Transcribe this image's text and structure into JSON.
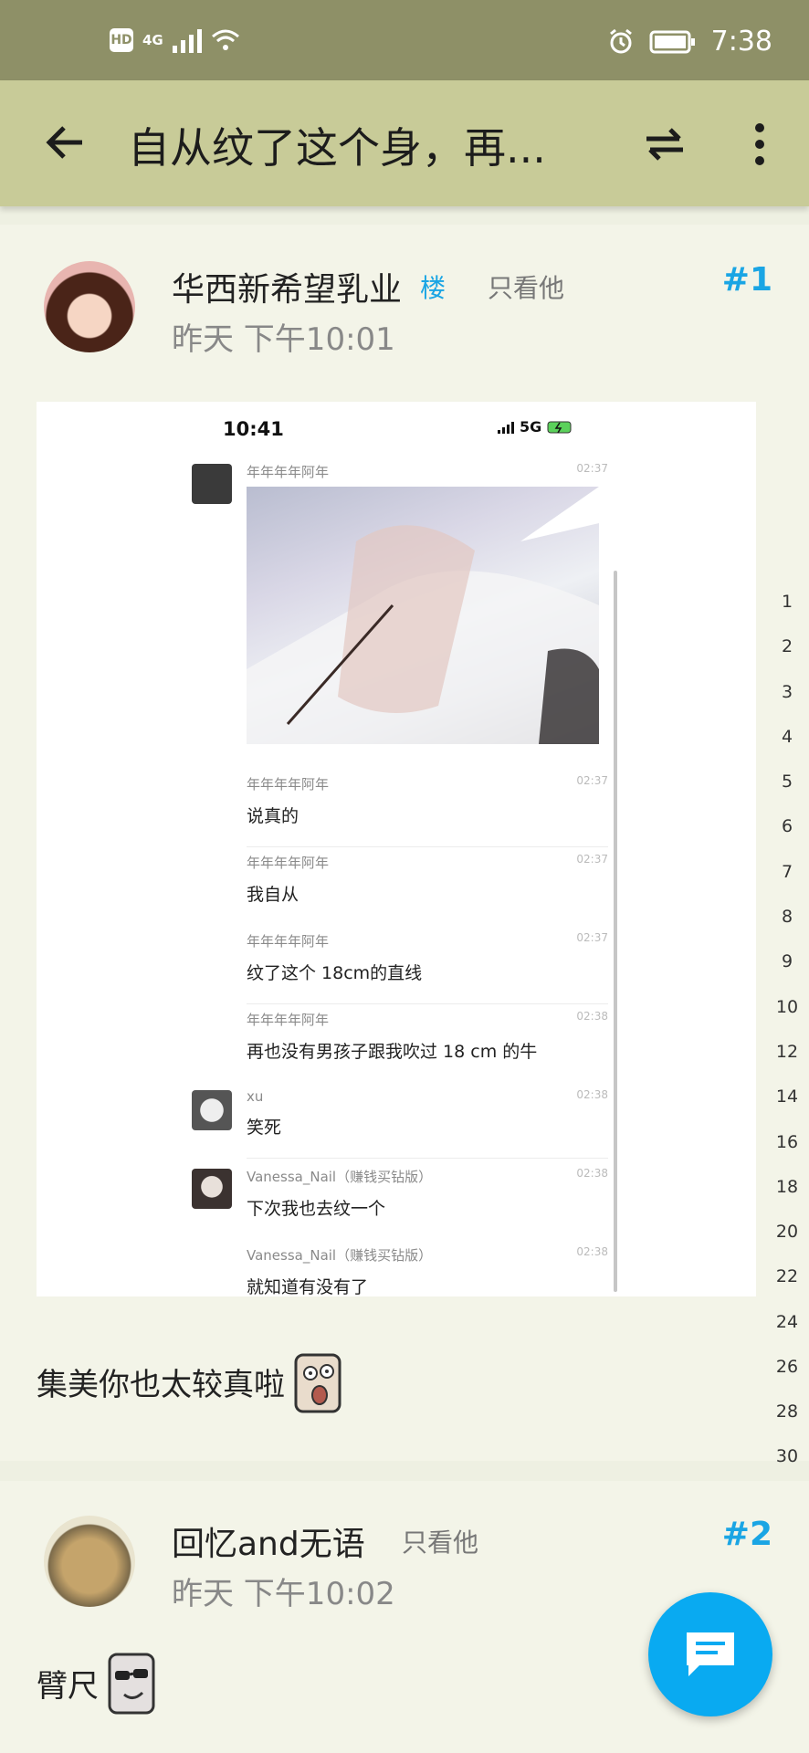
{
  "status_bar": {
    "time": "7:38",
    "hd": "HD",
    "network": "4G"
  },
  "toolbar": {
    "title": "自从纹了这个身，再..."
  },
  "posts": [
    {
      "username": "华西新希望乳业",
      "op_badge": "楼",
      "only_him": "只看他",
      "floor": "#1",
      "time": "昨天 下午10:01",
      "text": "集美你也太较真啦"
    },
    {
      "username": "回忆and无语",
      "only_him": "只看他",
      "floor": "#2",
      "time": "昨天 下午10:02",
      "text": "臂尺"
    }
  ],
  "screenshot": {
    "time": "10:41",
    "network": "5G",
    "messages": [
      {
        "sender": "年年年年阿年",
        "text": "",
        "time": "02:37"
      },
      {
        "sender": "年年年年阿年",
        "text": "说真的",
        "time": "02:37"
      },
      {
        "sender": "年年年年阿年",
        "text": "我自从",
        "time": "02:37"
      },
      {
        "sender": "年年年年阿年",
        "text": "纹了这个 18cm的直线",
        "time": "02:37"
      },
      {
        "sender": "年年年年阿年",
        "text": "再也没有男孩子跟我吹过 18 cm 的牛",
        "time": "02:38"
      },
      {
        "sender": "xu",
        "text": "笑死",
        "time": "02:38"
      },
      {
        "sender": "Vanessa_Nail（赚钱买钻版）",
        "text": "下次我也去纹一个",
        "time": "02:38"
      },
      {
        "sender": "Vanessa_Nail（赚钱买钻版）",
        "text": "就知道有没有了",
        "time": "02:38"
      }
    ]
  },
  "page_ladder": [
    "1",
    "2",
    "3",
    "4",
    "5",
    "6",
    "7",
    "8",
    "9",
    "10",
    "12",
    "14",
    "16",
    "18",
    "20",
    "22",
    "24",
    "26",
    "28",
    "30"
  ],
  "colors": {
    "accent": "#1aa5e4",
    "toolbar": "#c8cb98",
    "statusbar": "#8e9067",
    "fab": "#09aaf1"
  },
  "icons": [
    "back-arrow-icon",
    "swap-icon",
    "more-vert-icon",
    "chat-icon",
    "alarm-icon",
    "battery-icon",
    "wifi-icon",
    "signal-icon"
  ]
}
